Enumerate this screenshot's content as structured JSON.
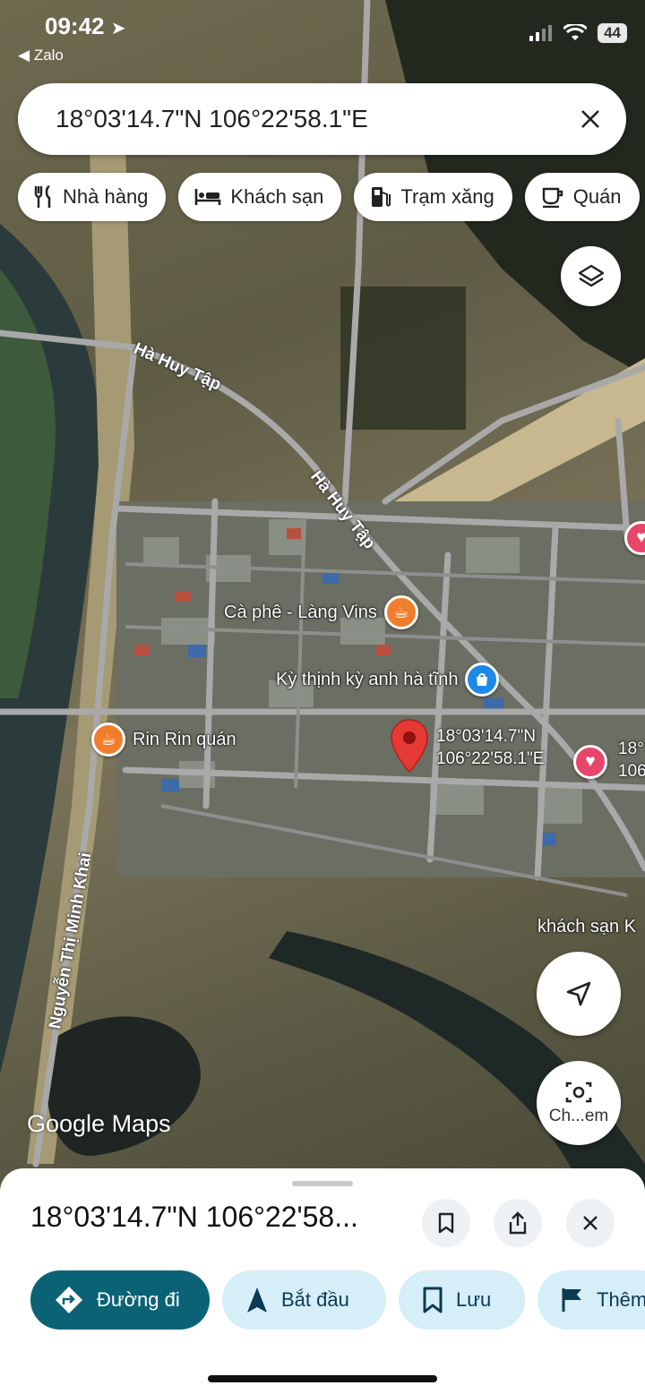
{
  "status": {
    "time": "09:42",
    "back_app": "Zalo",
    "battery": "44"
  },
  "search": {
    "value": "18°03'14.7\"N 106°22'58.1\"E"
  },
  "chips": [
    {
      "label": "Nhà hàng",
      "icon": "restaurant-icon"
    },
    {
      "label": "Khách sạn",
      "icon": "hotel-icon"
    },
    {
      "label": "Trạm xăng",
      "icon": "gas-station-icon"
    },
    {
      "label": "Quán",
      "icon": "cafe-icon"
    }
  ],
  "map": {
    "roads": [
      "Hà Huy Tập",
      "Hà Huy Tập",
      "Nguyễn Thị Minh Khai"
    ],
    "pois": [
      {
        "label": "Cà phê - Làng Vins",
        "icon": "coffee-icon"
      },
      {
        "label": "Kỳ thịnh kỳ anh hà tĩnh",
        "icon": "shopping-icon"
      },
      {
        "label": "Rin Rin quán",
        "icon": "coffee-icon"
      },
      {
        "label": "khách sạn K",
        "icon": ""
      }
    ],
    "pin_label_line1": "18°03'14.7\"N",
    "pin_label_line2": "106°22'58.1\"E",
    "side_label_line1": "18°",
    "side_label_line2": "106",
    "logo": "Google Maps"
  },
  "lens_label": "Ch...em",
  "sheet": {
    "title": "18°03'14.7\"N 106°22'58...",
    "actions": [
      {
        "label": "Đường đi",
        "icon": "directions-icon"
      },
      {
        "label": "Bắt đầu",
        "icon": "navigate-icon"
      },
      {
        "label": "Lưu",
        "icon": "bookmark-icon"
      },
      {
        "label": "Thêm",
        "icon": "flag-icon"
      }
    ]
  },
  "colors": {
    "accent": "#0b6275",
    "pin": "#e53935",
    "secondary_bg": "#d5eef7"
  }
}
